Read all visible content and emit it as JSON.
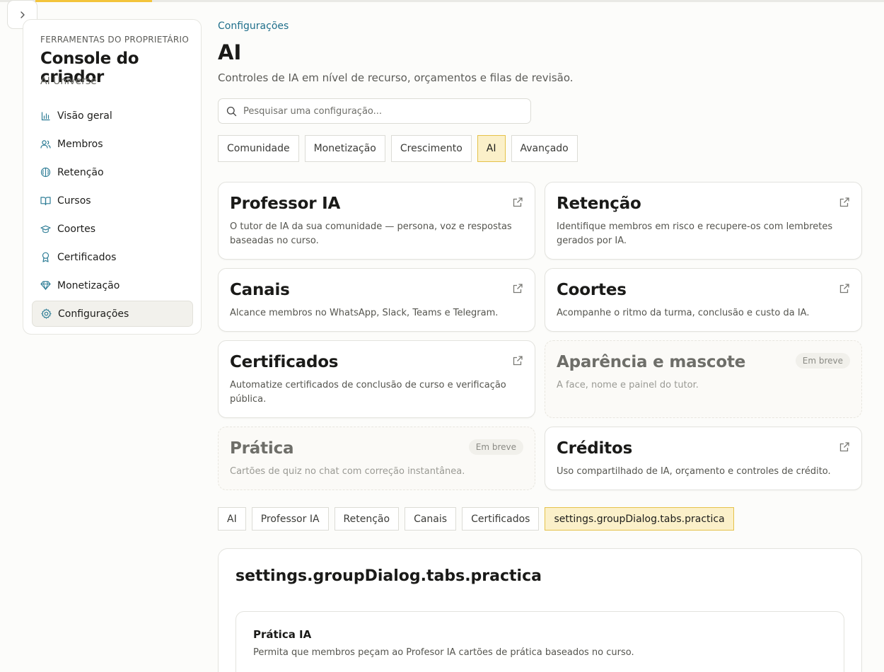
{
  "sidebar": {
    "owner_label": "FERRAMENTAS DO PROPRIETÁRIO",
    "title": "Console do criador",
    "community": "AI Universe",
    "items": [
      {
        "label": "Visão geral",
        "icon": "bar-chart-icon"
      },
      {
        "label": "Membros",
        "icon": "users-icon"
      },
      {
        "label": "Retenção",
        "icon": "brain-icon"
      },
      {
        "label": "Cursos",
        "icon": "book-icon"
      },
      {
        "label": "Coortes",
        "icon": "graduation-cap-icon"
      },
      {
        "label": "Certificados",
        "icon": "award-icon"
      },
      {
        "label": "Monetização",
        "icon": "gem-icon"
      },
      {
        "label": "Configurações",
        "icon": "gear-icon",
        "active": true
      }
    ]
  },
  "main": {
    "breadcrumb": "Configurações",
    "title": "AI",
    "subtitle": "Controles de IA em nível de recurso, orçamentos e filas de revisão.",
    "search": {
      "placeholder": "Pesquisar uma configuração..."
    },
    "tabs": [
      {
        "label": "Comunidade"
      },
      {
        "label": "Monetização"
      },
      {
        "label": "Crescimento"
      },
      {
        "label": "AI",
        "active": true
      },
      {
        "label": "Avançado"
      }
    ],
    "cards": [
      {
        "title": "Professor IA",
        "desc": "O tutor de IA da sua comunidade — persona, voz e respostas baseadas no curso."
      },
      {
        "title": "Retenção",
        "desc": "Identifique membros em risco e recupere-os com lembretes gerados por IA."
      },
      {
        "title": "Canais",
        "desc": "Alcance membros no WhatsApp, Slack, Teams e Telegram."
      },
      {
        "title": "Coortes",
        "desc": "Acompanhe o ritmo da turma, conclusão e custo da IA."
      },
      {
        "title": "Certificados",
        "desc": "Automatize certificados de conclusão de curso e verificação pública."
      },
      {
        "title": "Aparência e mascote",
        "desc": "A face, nome e painel do tutor.",
        "badge": "Em breve"
      },
      {
        "title": "Prática",
        "desc": "Cartões de quiz no chat com correção instantânea.",
        "badge": "Em breve"
      },
      {
        "title": "Créditos",
        "desc": "Uso compartilhado de IA, orçamento e controles de crédito."
      }
    ],
    "subtabs": [
      {
        "label": "AI"
      },
      {
        "label": "Professor IA"
      },
      {
        "label": "Retenção"
      },
      {
        "label": "Canais"
      },
      {
        "label": "Certificados"
      },
      {
        "label": "settings.groupDialog.tabs.practica",
        "active": true
      }
    ],
    "panel": {
      "title": "settings.groupDialog.tabs.practica",
      "subcard": {
        "title": "Prática IA",
        "desc": "Permita que membros peçam ao Profesor IA cartões de prática baseados no curso."
      }
    }
  },
  "colors": {
    "accent": "#f3c43b",
    "active_tab_bg": "#fbf0c9",
    "active_tab_border": "#e5c24a",
    "link": "#1f6f8b",
    "icon_teal": "#2e7d96"
  }
}
